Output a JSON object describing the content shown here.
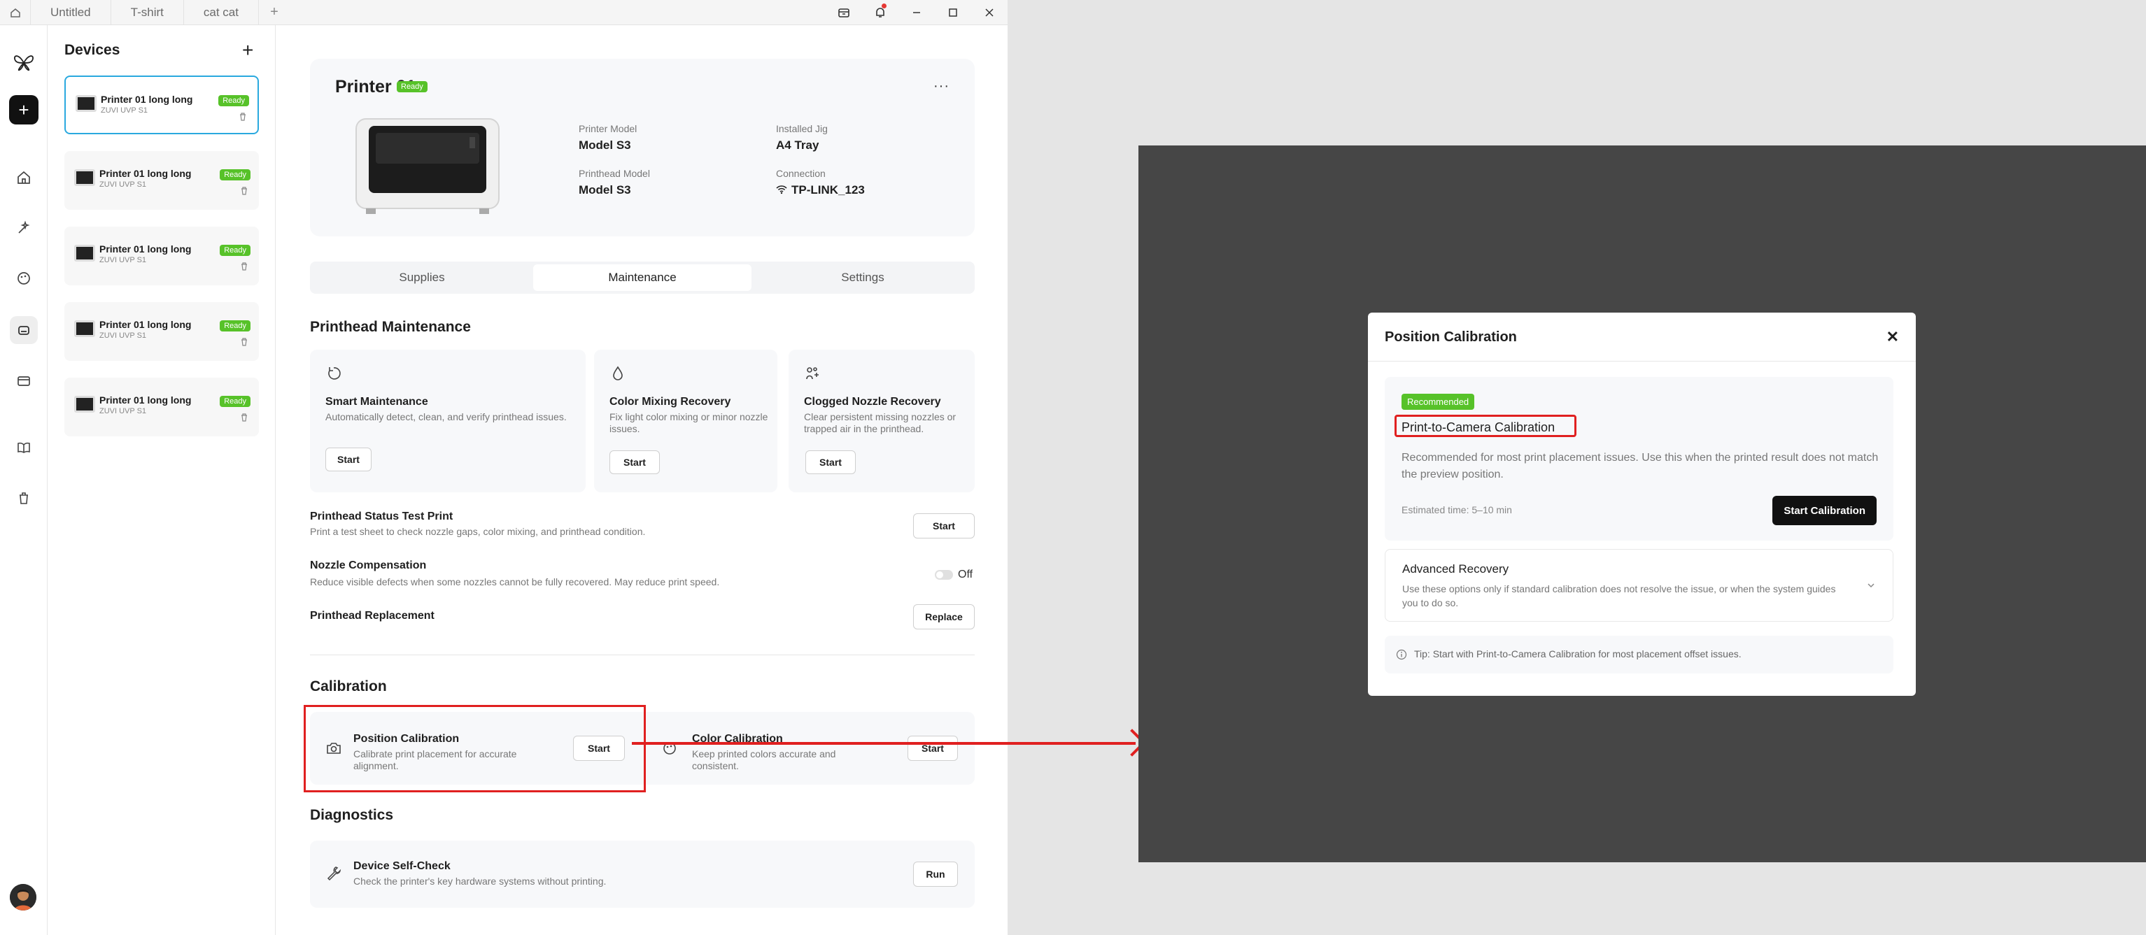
{
  "topbar": {
    "tabs": [
      "Untitled",
      "T-shirt",
      "cat cat"
    ],
    "add_tab": "+"
  },
  "devices": {
    "title": "Devices",
    "add": "+",
    "items": [
      {
        "name": "Printer 01 long long",
        "model": "ZUVI UVP S1",
        "status": "Ready",
        "selected": true
      },
      {
        "name": "Printer 01 long long",
        "model": "ZUVI UVP S1",
        "status": "Ready"
      },
      {
        "name": "Printer 01 long long",
        "model": "ZUVI UVP S1",
        "status": "Ready"
      },
      {
        "name": "Printer 01 long long",
        "model": "ZUVI UVP S1",
        "status": "Ready"
      },
      {
        "name": "Printer 01 long long",
        "model": "ZUVI UVP S1",
        "status": "Ready"
      }
    ]
  },
  "printer": {
    "name": "Printer 01",
    "status": "Ready",
    "more": "···",
    "specs": {
      "model_label": "Printer Model",
      "model_value": "Model S3",
      "jig_label": "Installed Jig",
      "jig_value": "A4 Tray",
      "head_label": "Printhead Model",
      "head_value": "Model S3",
      "conn_label": "Connection",
      "conn_value": "TP-LINK_123"
    }
  },
  "tabs": {
    "supplies": "Supplies",
    "maintenance": "Maintenance",
    "settings": "Settings",
    "active": "Maintenance"
  },
  "printhead": {
    "title": "Printhead Maintenance",
    "cards": [
      {
        "title": "Smart Maintenance",
        "desc": "Automatically detect, clean, and verify printhead issues.",
        "button": "Start"
      },
      {
        "title": "Color Mixing Recovery",
        "desc": "Fix light color mixing or minor nozzle issues.",
        "button": "Start"
      },
      {
        "title": "Clogged Nozzle Recovery",
        "desc": "Clear persistent missing nozzles or trapped air in the printhead.",
        "button": "Start"
      }
    ],
    "test_print": {
      "title": "Printhead Status Test Print",
      "desc": "Print a test sheet to check nozzle gaps, color mixing, and printhead condition.",
      "button": "Start"
    },
    "nozzle_comp": {
      "title": "Nozzle Compensation",
      "desc": "Reduce visible defects when some nozzles cannot be fully recovered. May reduce print speed.",
      "state": "Off"
    },
    "replacement": {
      "title": "Printhead Replacement",
      "button": "Replace"
    }
  },
  "calibration": {
    "title": "Calibration",
    "position": {
      "title": "Position Calibration",
      "desc": "Calibrate print placement for accurate alignment.",
      "button": "Start"
    },
    "color": {
      "title": "Color Calibration",
      "desc": "Keep printed colors accurate and consistent.",
      "button": "Start"
    }
  },
  "diagnostics": {
    "title": "Diagnostics",
    "selfcheck": {
      "title": "Device Self-Check",
      "desc": "Check the printer's key hardware systems without printing.",
      "button": "Run"
    }
  },
  "modal": {
    "title": "Position Calibration",
    "close": "✕",
    "recommended": {
      "badge": "Recommended",
      "title": "Print-to-Camera Calibration",
      "desc": "Recommended for most print placement issues. Use this when the printed result does not match the preview position.",
      "estimate": "Estimated time: 5–10 min",
      "button": "Start Calibration"
    },
    "advanced": {
      "title": "Advanced Recovery",
      "desc": "Use these options only if standard calibration does not resolve the issue, or when the system guides you to do so."
    },
    "tip": "Tip: Start with Print-to-Camera Calibration for most placement offset issues."
  },
  "colors": {
    "accent_green": "#57c229",
    "highlight_red": "#e02020",
    "selected_border": "#2aa9df",
    "overlay": "#464646"
  }
}
